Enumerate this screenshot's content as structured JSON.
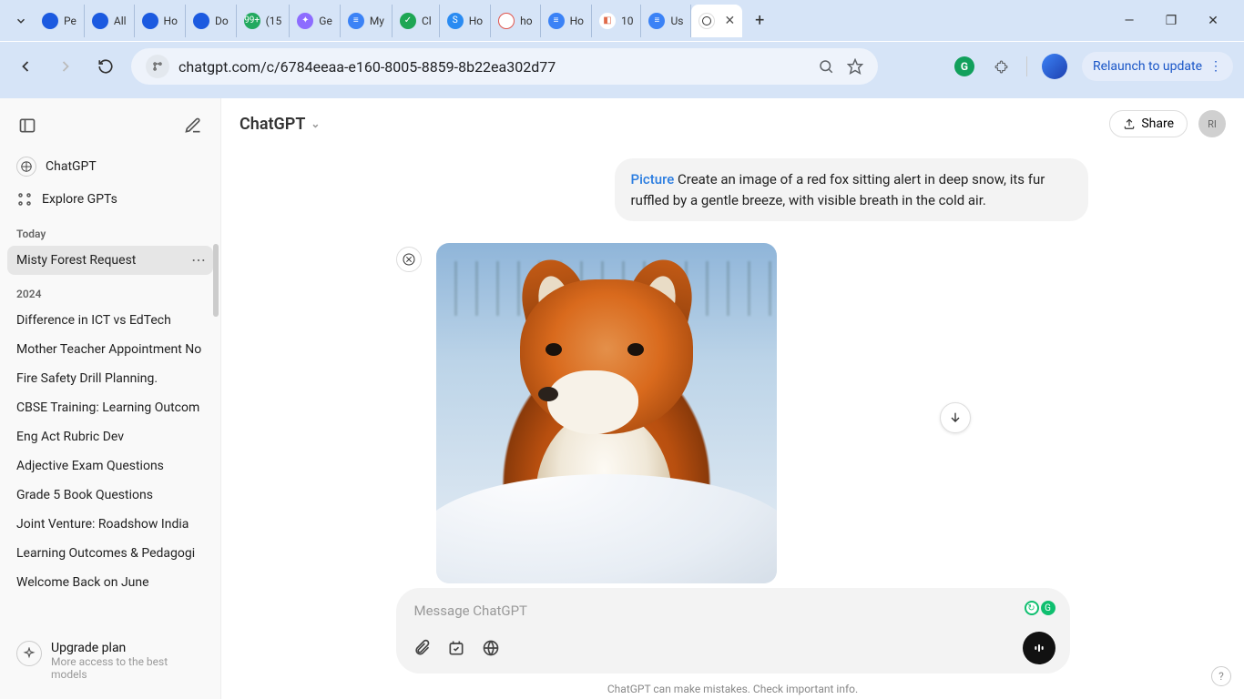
{
  "browser": {
    "tabs": [
      {
        "label": "Pe",
        "favicon_bg": "#1c5ae0",
        "favicon_text": ""
      },
      {
        "label": "All",
        "favicon_bg": "#1c5ae0",
        "favicon_text": ""
      },
      {
        "label": "Ho",
        "favicon_bg": "#1c5ae0",
        "favicon_text": ""
      },
      {
        "label": "Do",
        "favicon_bg": "#1c5ae0",
        "favicon_text": ""
      },
      {
        "label": "(15",
        "favicon_bg": "#22a95f",
        "favicon_text": "99+"
      },
      {
        "label": "Ge",
        "favicon_bg": "#8d6cff",
        "favicon_text": "✦"
      },
      {
        "label": "My",
        "favicon_bg": "#3b82f6",
        "favicon_text": "≡"
      },
      {
        "label": "Cl",
        "favicon_bg": "#1ea654",
        "favicon_text": "✓"
      },
      {
        "label": "Ho",
        "favicon_bg": "#2a8bf2",
        "favicon_text": "S"
      },
      {
        "label": "ho",
        "favicon_bg": "#ffffff",
        "favicon_text": "⌗",
        "favicon_border": "#e0554e"
      },
      {
        "label": "Ho",
        "favicon_bg": "#3b82f6",
        "favicon_text": "≡"
      },
      {
        "label": "10",
        "favicon_bg": "#ffffff",
        "favicon_text": "◧",
        "favicon_color": "#e06a4a"
      },
      {
        "label": "Us",
        "favicon_bg": "#3b82f6",
        "favicon_text": "≡"
      }
    ],
    "active_tab": {
      "label": ""
    },
    "url": "chatgpt.com/c/6784eeaa-e160-8005-8859-8b22ea302d77",
    "relaunch_label": "Relaunch to update"
  },
  "sidebar": {
    "chatgpt_label": "ChatGPT",
    "explore_label": "Explore GPTs",
    "sections": [
      {
        "title": "Today",
        "items": [
          "Misty Forest Request"
        ],
        "active_index": 0
      },
      {
        "title": "2024",
        "items": [
          "Difference in ICT vs EdTech",
          "Mother Teacher Appointment No",
          "Fire Safety Drill Planning.",
          "CBSE Training: Learning Outcom",
          "Eng Act Rubric Dev",
          "Adjective Exam Questions",
          "Grade 5 Book Questions",
          "Joint Venture: Roadshow India",
          "Learning Outcomes & Pedagogi",
          "Welcome Back on June"
        ]
      }
    ],
    "upgrade_title": "Upgrade plan",
    "upgrade_subtitle": "More access to the best models"
  },
  "header": {
    "model": "ChatGPT",
    "share_label": "Share",
    "avatar_initials": "RI"
  },
  "conversation": {
    "user_prefix": "Picture",
    "user_text": " Create an image of a red fox sitting alert in deep snow, its fur ruffled by a gentle breeze, with visible breath in the cold air.",
    "image_alt": "Generated image of a red fox in snow"
  },
  "composer": {
    "placeholder": "Message ChatGPT"
  },
  "footer": {
    "note": "ChatGPT can make mistakes. Check important info."
  }
}
